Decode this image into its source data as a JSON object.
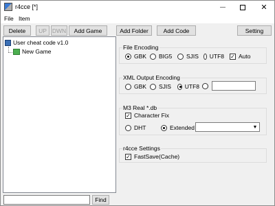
{
  "window": {
    "title": "r4cce [*]",
    "controls": {
      "minimize": "—",
      "close": "✕"
    }
  },
  "menu": [
    "File",
    "Item"
  ],
  "toolbar": {
    "delete": "Delete",
    "up": "UP",
    "down": "DWN",
    "add_game": "Add Game",
    "add_folder": "Add Folder",
    "add_code": "Add Code",
    "setting": "Setting"
  },
  "tree": {
    "root": "User cheat code v1.0",
    "child": "New Game"
  },
  "find": {
    "value": "",
    "button": "Find"
  },
  "file_encoding": {
    "title": "File Encoding",
    "options": [
      "GBK",
      "BIG5",
      "SJIS",
      "UTF8"
    ],
    "selected": "GBK",
    "auto_label": "Auto",
    "auto_checked": true
  },
  "xml_encoding": {
    "title": "XML Output Encoding",
    "options": [
      "GBK",
      "SJIS",
      "UTF8"
    ],
    "selected": "UTF8",
    "custom_value": ""
  },
  "m3": {
    "title": "M3 Real *.db",
    "char_fix_label": "Character Fix",
    "char_fix_checked": true,
    "dht_label": "DHT",
    "extended_label": "Extended",
    "selected": "Extended",
    "extended_value": ""
  },
  "r4cce_settings": {
    "title": "r4cce Settings",
    "fastsave_label": "FastSave(Cache)",
    "fastsave_checked": true
  }
}
